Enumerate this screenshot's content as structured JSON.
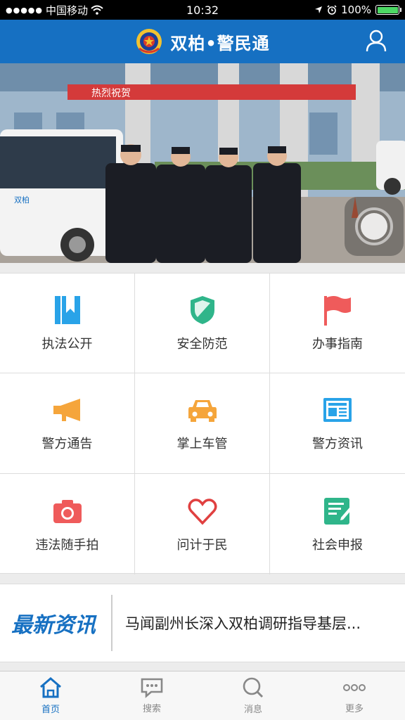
{
  "status_bar": {
    "carrier": "中国移动",
    "time": "10:32",
    "battery": "100%",
    "battery_level": 1.0
  },
  "header": {
    "title": "双柏•警民通",
    "logo": "police-emblem-icon",
    "user_icon": "user-icon"
  },
  "banner": {
    "slide_count": 4,
    "active_index": 2,
    "sign_text": "热烈祝贺",
    "bus_text": "双柏"
  },
  "grid": {
    "items": [
      {
        "label": "执法公开",
        "icon": "book-icon",
        "color": "#29a3e8"
      },
      {
        "label": "安全防范",
        "icon": "shield-icon",
        "color": "#2fb58a"
      },
      {
        "label": "办事指南",
        "icon": "flag-icon",
        "color": "#ef5b5b"
      },
      {
        "label": "警方通告",
        "icon": "megaphone-icon",
        "color": "#f5a53b"
      },
      {
        "label": "掌上车管",
        "icon": "car-icon",
        "color": "#f5a53b"
      },
      {
        "label": "警方资讯",
        "icon": "newspaper-icon",
        "color": "#29a3e8"
      },
      {
        "label": "违法随手拍",
        "icon": "camera-icon",
        "color": "#ef5b5b"
      },
      {
        "label": "问计于民",
        "icon": "heart-icon",
        "color": "#e04040"
      },
      {
        "label": "社会申报",
        "icon": "form-icon",
        "color": "#2fb58a"
      }
    ]
  },
  "news": {
    "badge": "最新资讯",
    "headline": "马闻副州长深入双柏调研指导基层..."
  },
  "tabs": [
    {
      "label": "首页",
      "icon": "home-icon",
      "active": true
    },
    {
      "label": "搜索",
      "icon": "chat-icon",
      "active": false
    },
    {
      "label": "消息",
      "icon": "search-icon",
      "active": false
    },
    {
      "label": "更多",
      "icon": "more-icon",
      "active": false
    }
  ],
  "colors": {
    "primary": "#1670c2",
    "inactive": "#888888"
  }
}
